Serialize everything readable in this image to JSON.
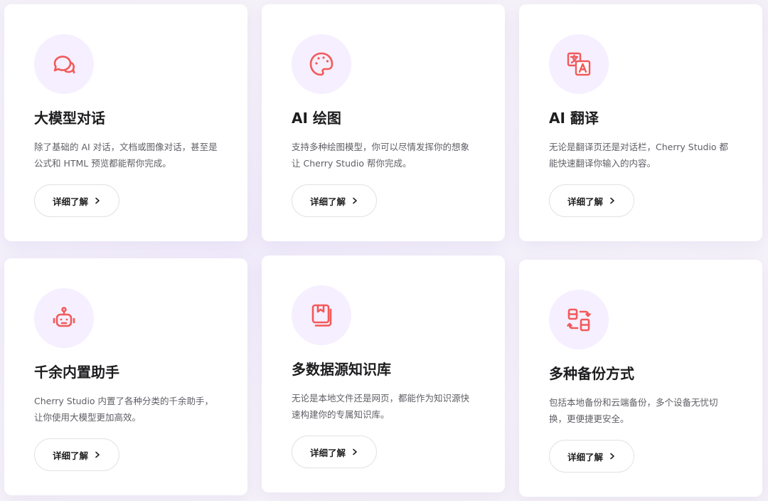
{
  "accent_color": "#f25a5a",
  "icon_bg_color": "#f6efff",
  "cards": [
    {
      "icon": "chat-bubbles-icon",
      "title": "大模型对话",
      "desc": "除了基础的 AI 对话，文档或图像对话，甚至是公式和 HTML 预览都能帮你完成。",
      "button_label": "详细了解"
    },
    {
      "icon": "palette-icon",
      "title": "AI 绘图",
      "desc": "支持多种绘图模型，你可以尽情发挥你的想象让 Cherry Studio 帮你完成。",
      "button_label": "详细了解"
    },
    {
      "icon": "translate-icon",
      "title": "AI 翻译",
      "desc": "无论是翻译页还是对话栏，Cherry Studio 都能快速翻译你输入的内容。",
      "button_label": "详细了解"
    },
    {
      "icon": "robot-icon",
      "title": "千余内置助手",
      "desc": "Cherry Studio 内置了各种分类的千余助手，让你使用大模型更加高效。",
      "button_label": "详细了解"
    },
    {
      "icon": "knowledge-base-icon",
      "title": "多数据源知识库",
      "desc": "无论是本地文件还是网页，都能作为知识源快速构建你的专属知识库。",
      "button_label": "详细了解"
    },
    {
      "icon": "backup-sync-icon",
      "title": "多种备份方式",
      "desc": "包括本地备份和云端备份，多个设备无忧切换，更便捷更安全。",
      "button_label": "详细了解"
    }
  ]
}
